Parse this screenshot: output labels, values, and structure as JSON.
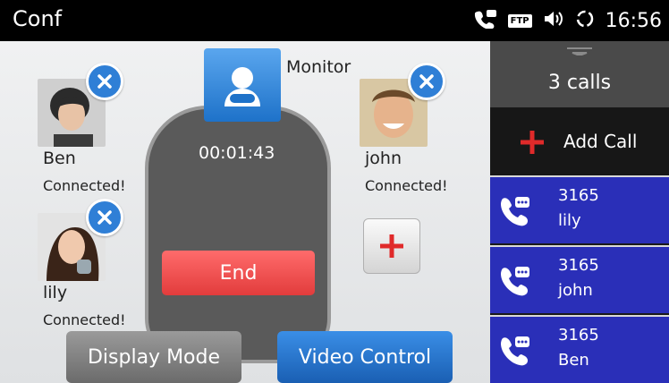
{
  "status_bar": {
    "title": "Conf",
    "ftp_badge": "FTP",
    "time": "16:56"
  },
  "conference": {
    "monitor_label": "Monitor",
    "timer": "00:01:43",
    "end_label": "End",
    "participants": [
      {
        "name": "Ben",
        "state": "Connected!"
      },
      {
        "name": "john",
        "state": "Connected!"
      },
      {
        "name": "lily",
        "state": "Connected!"
      }
    ]
  },
  "bottom_buttons": {
    "display_mode": "Display Mode",
    "video_control": "Video Control"
  },
  "side_panel": {
    "calls_count": "3 calls",
    "add_call": "Add Call",
    "calls": [
      {
        "number": "3165",
        "name": "lily"
      },
      {
        "number": "3165",
        "name": "john"
      },
      {
        "number": "3165",
        "name": "Ben"
      }
    ]
  },
  "colors": {
    "accent_blue": "#2f7fd6",
    "end_red": "#e23c3c",
    "call_list_blue": "#2a2fb8"
  }
}
